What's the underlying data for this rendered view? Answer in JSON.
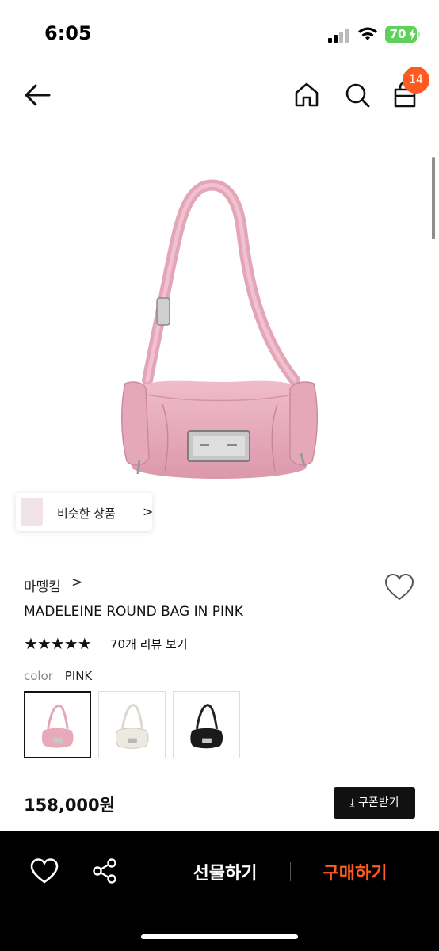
{
  "status_bar": {
    "time": "6:05",
    "battery": "70"
  },
  "header": {
    "cart_count": "14"
  },
  "similar": {
    "label": "비슷한 상품",
    "chevron": ">"
  },
  "product": {
    "brand": "마뗑킴",
    "brand_chevron": ">",
    "title": "MADELEINE ROUND BAG IN PINK",
    "stars": "★★★★★",
    "rating_fraction": 1.0,
    "review_link": "70개 리뷰 보기",
    "color_label": "color",
    "color_value": "PINK",
    "swatches": [
      {
        "name": "pink",
        "color": "#e8a9bb"
      },
      {
        "name": "cream",
        "color": "#ece9e1"
      },
      {
        "name": "black",
        "color": "#1a1a1a"
      }
    ],
    "price": "158,000원",
    "coupon": "⤓ 쿠폰받기"
  },
  "bottom_bar": {
    "gift": "선물하기",
    "buy": "구매하기",
    "buy_color": "#ff5a1f"
  },
  "colors": {
    "accent": "#ff5a1f",
    "bag_pink": "#e8a9bb"
  }
}
